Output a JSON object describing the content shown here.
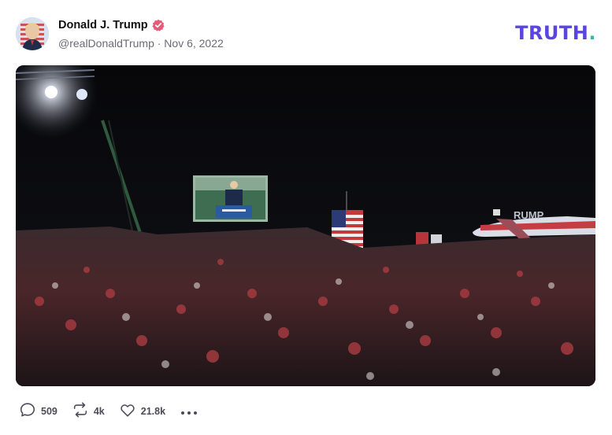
{
  "post": {
    "author_name": "Donald J. Trump",
    "handle_date": "@realDonaldTrump · Nov 6, 2022",
    "verified_badge_color": "#e85a75",
    "image_alt": "Rally crowd at night with large screen and flags"
  },
  "brand": {
    "logo_text": "TRUTH",
    "logo_dot": ".",
    "logo_color": "#5b45e0",
    "dot_color": "#23c4a0"
  },
  "photo_overlay": {
    "plane_text": "RUMP"
  },
  "actions": {
    "replies": "509",
    "retruths": "4k",
    "likes": "21.8k"
  },
  "icons": [
    "verified-badge-icon",
    "reply-icon",
    "retruth-icon",
    "like-icon",
    "more-icon"
  ]
}
